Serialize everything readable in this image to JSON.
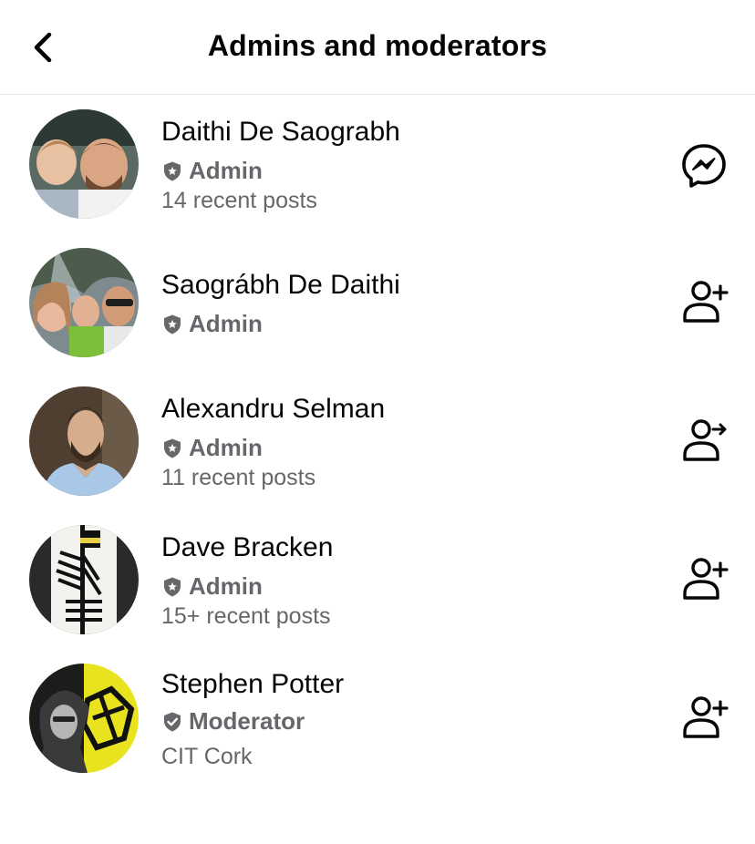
{
  "header": {
    "title": "Admins and moderators",
    "back_icon": "chevron-left-icon"
  },
  "members": [
    {
      "name": "Daithi De Saograbh",
      "role": "Admin",
      "meta": "14 recent posts",
      "action_icon": "messenger-icon"
    },
    {
      "name": "Saográbh De Daithi",
      "role": "Admin",
      "meta": "",
      "action_icon": "add-friend-icon"
    },
    {
      "name": "Alexandru Selman",
      "role": "Admin",
      "meta": "11 recent posts",
      "action_icon": "friend-request-sent-icon"
    },
    {
      "name": "Dave Bracken",
      "role": "Admin",
      "meta": "15+ recent posts",
      "action_icon": "add-friend-icon"
    },
    {
      "name": "Stephen Potter",
      "role": "Moderator",
      "meta": "CIT Cork",
      "action_icon": "add-friend-icon"
    }
  ],
  "colors": {
    "text": "#050505",
    "secondary": "#65676b",
    "divider": "#e4e6eb"
  }
}
